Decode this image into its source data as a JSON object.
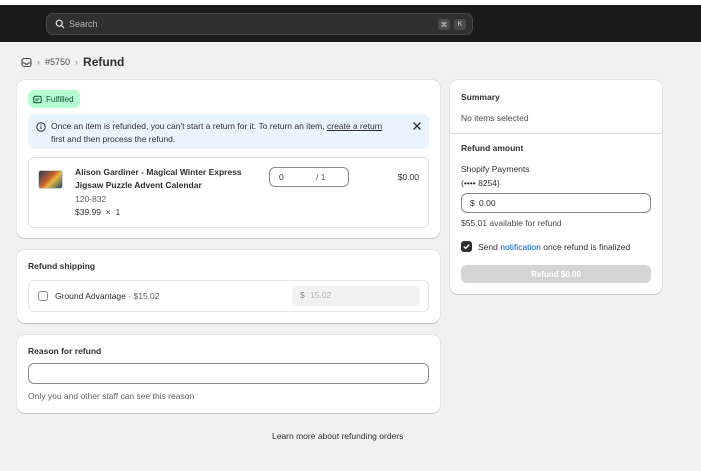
{
  "search": {
    "placeholder": "Search",
    "shortcut_keys": [
      "⌘",
      "K"
    ]
  },
  "breadcrumb": {
    "order": "#5750",
    "title": "Refund"
  },
  "fulfilled_card": {
    "badge": "Fulfilled",
    "banner": {
      "text_before": "Once an item is refunded, you can't start a return for it. To return an item,",
      "link": "create a return",
      "text_after": "first and then process the refund."
    },
    "item": {
      "name": "Alison Gardiner - Magical Winter Express Jigsaw Puzzle Advent Calendar",
      "sku": "120-832",
      "unit_price": "$39.99",
      "times": "×",
      "ordered_qty": "1",
      "refund_qty": "0",
      "max_qty": "/ 1",
      "total": "$0.00"
    }
  },
  "refund_shipping": {
    "title": "Refund shipping",
    "method": "Ground Advantage",
    "separator": "·",
    "amount": "$15.02",
    "currency": "$",
    "input_placeholder": "15.02"
  },
  "reason": {
    "title": "Reason for refund",
    "value": "",
    "help": "Only you and other staff can see this reason"
  },
  "learn_more": "Learn more about refunding orders",
  "summary": {
    "title": "Summary",
    "status": "No items selected",
    "refund_amount_title": "Refund amount",
    "gateway": "Shopify Payments",
    "card": "(•••• 8254)",
    "currency": "$",
    "amount": "0.00",
    "available": "$55.01 available for refund",
    "send_before": "Send",
    "send_link": "notification",
    "send_after": "once refund is finalized",
    "notify_checked": true,
    "button": "Refund $0.00"
  }
}
